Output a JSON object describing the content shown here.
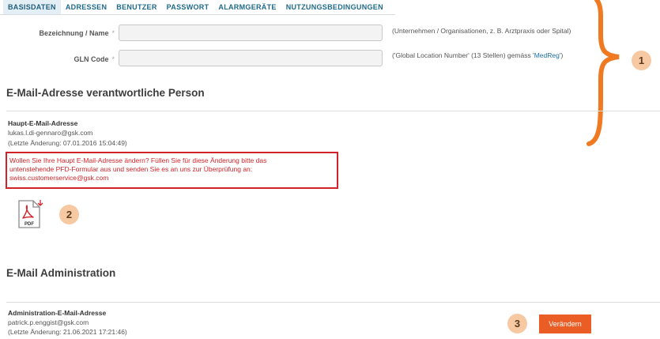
{
  "tabs": [
    {
      "label": "BASISDATEN",
      "active": true
    },
    {
      "label": "ADRESSEN"
    },
    {
      "label": "BENUTZER"
    },
    {
      "label": "PASSWORT"
    },
    {
      "label": "ALARMGERÄTE"
    },
    {
      "label": "NUTZUNGSBEDINGUNGEN"
    }
  ],
  "form": {
    "name_label": "Bezeichnung / Name",
    "name_value": "",
    "name_hint": "(Unternehmen / Organisationen, z. B. Arztpraxis oder Spital)",
    "gln_label": "GLN Code",
    "gln_value": "",
    "gln_hint_prefix": "('Global Location Number' (13 Stellen) gemäss '",
    "gln_hint_link": "MedReg",
    "gln_hint_suffix": "')",
    "required_mark": "*"
  },
  "email_section": {
    "title": "E-Mail-Adresse verantwortliche Person",
    "main_label": "Haupt-E-Mail-Adresse",
    "main_email": "lukas.l.di-gennaro@gsk.com",
    "main_changed": "(Letzte Änderung: 07.01.2016 15:04:49)",
    "warning_lines": [
      "Wollen Sie Ihre Haupt E-Mail-Adresse ändern? Füllen Sie für diese Änderung bitte das",
      "untenstehende PFD-Formular aus und senden Sie es an uns zur Überprüfung an:",
      "swiss.customerservice@gsk.com"
    ],
    "pdf_icon": "pdf-file-icon",
    "pdf_text": "PDF"
  },
  "admin_section": {
    "title": "E-Mail Administration",
    "label": "Administration-E-Mail-Adresse",
    "email": "patrick.p.enggist@gsk.com",
    "changed": "(Letzte Änderung: 21.06.2021 17:21:46)",
    "change_button": "Verändern"
  },
  "markers": [
    "1",
    "2",
    "3"
  ],
  "colors": {
    "tab_text": "#1f6a8a",
    "tab_active_bg": "#e3eef5",
    "warning": "#d0242a",
    "accent_orange": "#ea5d24",
    "brace_orange": "#f07a22",
    "marker_bg": "#f6c9a3"
  }
}
